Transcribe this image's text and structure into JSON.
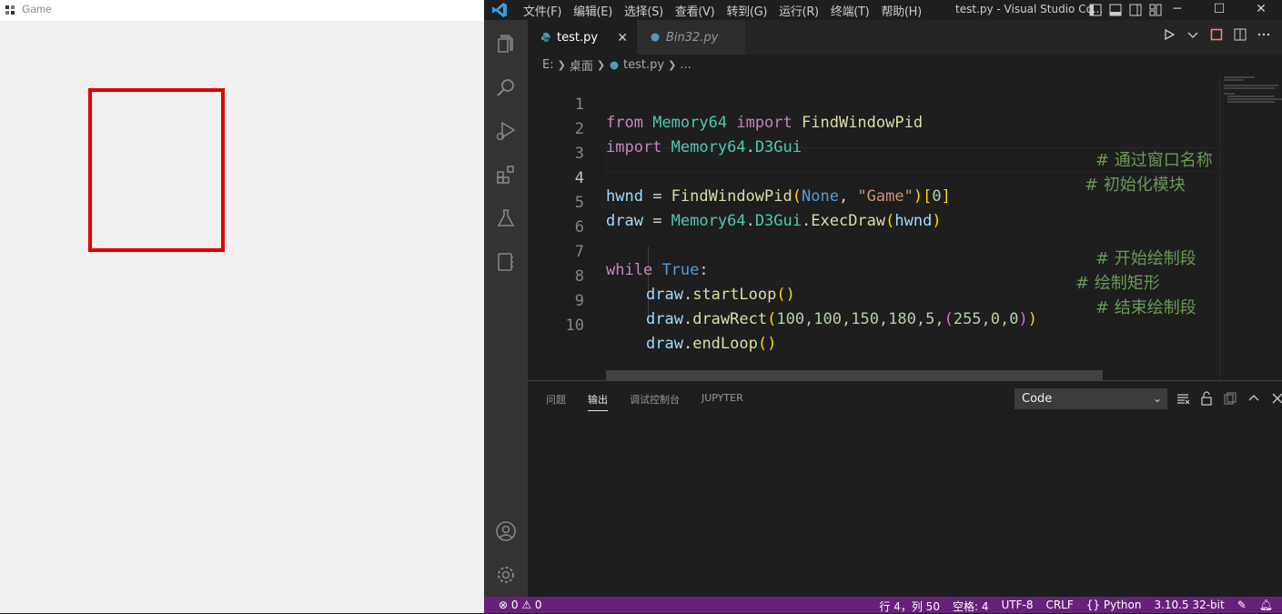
{
  "game_window": {
    "title": "Game"
  },
  "vscode": {
    "menu": [
      "文件(F)",
      "编辑(E)",
      "选择(S)",
      "查看(V)",
      "转到(G)",
      "运行(R)",
      "终端(T)",
      "帮助(H)"
    ],
    "window_title": "test.py - Visual Studio Co...",
    "tabs": [
      {
        "label": "test.py",
        "active": true
      },
      {
        "label": "Bin32.py",
        "active": false
      }
    ],
    "breadcrumb": {
      "drive": "E:",
      "folder": "桌面",
      "file": "test.py",
      "more": "..."
    },
    "code": {
      "line_numbers": [
        "1",
        "2",
        "3",
        "4",
        "5",
        "6",
        "7",
        "8",
        "9",
        "10"
      ],
      "l1": {
        "kw1": "from",
        "mod": "Memory64",
        "kw2": "import",
        "fn": "FindWindowPid"
      },
      "l2": {
        "kw": "import",
        "mod1": "Memory64",
        "dot": ".",
        "mod2": "D3Gui"
      },
      "l4": {
        "var": "hwnd",
        "eq": " = ",
        "fn": "FindWindowPid",
        "open": "(",
        "none": "None",
        "comma": ", ",
        "str": "\"Game\"",
        "close": ")",
        "ob": "[",
        "idx": "0",
        "cb": "]",
        "comment": "# 通过窗口名称"
      },
      "l5": {
        "var": "draw",
        "eq": " = ",
        "mod1": "Memory64",
        "dot": ".",
        "mod2": "D3Gui",
        "dot2": ".",
        "fn": "ExecDraw",
        "open": "(",
        "arg": "hwnd",
        "close": ")",
        "comment": "# 初始化模块"
      },
      "l7": {
        "kw": "while",
        "const": "True",
        "colon": ":"
      },
      "l8": {
        "var": "draw",
        "dot": ".",
        "fn": "startLoop",
        "parens": "()",
        "comment": "# 开始绘制段"
      },
      "l9": {
        "var": "draw",
        "dot": ".",
        "fn": "drawRect",
        "open": "(",
        "args": "100,100,150,180,5,",
        "open2": "(",
        "tuple": "255,0,0",
        "close2": ")",
        "close": ")",
        "comment": "# 绘制矩形"
      },
      "l10": {
        "var": "draw",
        "dot": ".",
        "fn": "endLoop",
        "parens": "()",
        "comment": "# 结束绘制段"
      }
    },
    "panel": {
      "tabs": [
        "问题",
        "输出",
        "调试控制台",
        "JUPYTER"
      ],
      "active_tab": "输出",
      "output_channel": "Code"
    },
    "status": {
      "problems": "⊗ 0 ⚠ 0",
      "position": "行 4，列 50",
      "spaces": "空格: 4",
      "encoding": "UTF-8",
      "eol": "CRLF",
      "language": "{} Python",
      "interpreter": "3.10.5 32-bit"
    },
    "colors": {
      "status_bar": "#68217a",
      "accent": "#007acc"
    }
  }
}
